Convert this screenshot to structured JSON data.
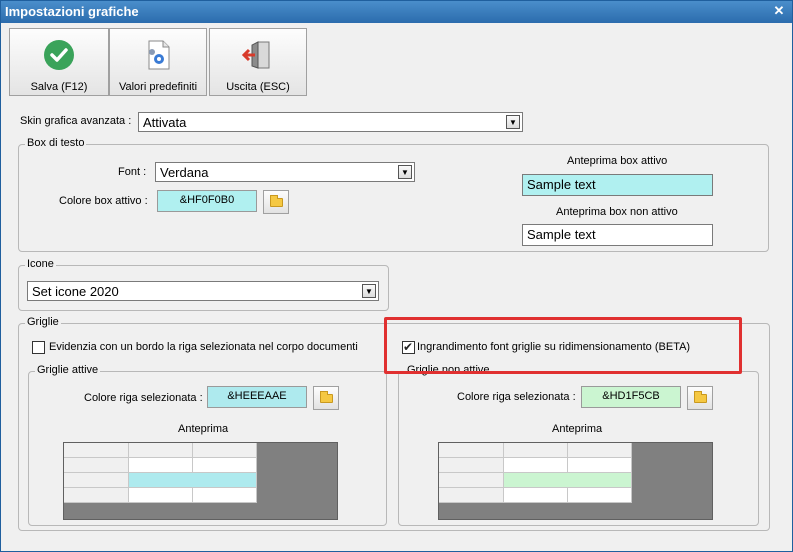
{
  "window": {
    "title": "Impostazioni grafiche"
  },
  "toolbar": {
    "save_label": "Salva (F12)",
    "defaults_label": "Valori predefiniti",
    "exit_label": "Uscita (ESC)"
  },
  "skin": {
    "label": "Skin grafica avanzata :",
    "value": "Attivata"
  },
  "textbox": {
    "group_title": "Box di testo",
    "font_label": "Font :",
    "font_value": "Verdana",
    "active_color_label": "Colore box attivo :",
    "active_color_value": "&HF0F0B0",
    "preview_active_label": "Anteprima box attivo",
    "preview_active_text": "Sample text",
    "preview_inactive_label": "Anteprima box non attivo",
    "preview_inactive_text": "Sample text"
  },
  "icons": {
    "group_title": "Icone",
    "value": "Set icone 2020"
  },
  "grids": {
    "group_title": "Griglie",
    "highlight_border_label": "Evidenzia con un bordo la riga selezionata nel corpo documenti",
    "font_resize_label": "Ingrandimento font griglie su ridimensionamento (BETA)",
    "active": {
      "group_title": "Griglie attive",
      "color_label": "Colore riga selezionata :",
      "color_value": "&HEEEAAE",
      "preview_label": "Anteprima"
    },
    "inactive": {
      "group_title": "Griglie non attive",
      "color_label": "Colore riga selezionata :",
      "color_value": "&HD1F5CB",
      "preview_label": "Anteprima"
    }
  },
  "colors": {
    "active_box": "#b0f0f0",
    "active_grid_row": "#aeeaee",
    "inactive_grid_row": "#cbf5d1",
    "highlight": "#e03030"
  }
}
